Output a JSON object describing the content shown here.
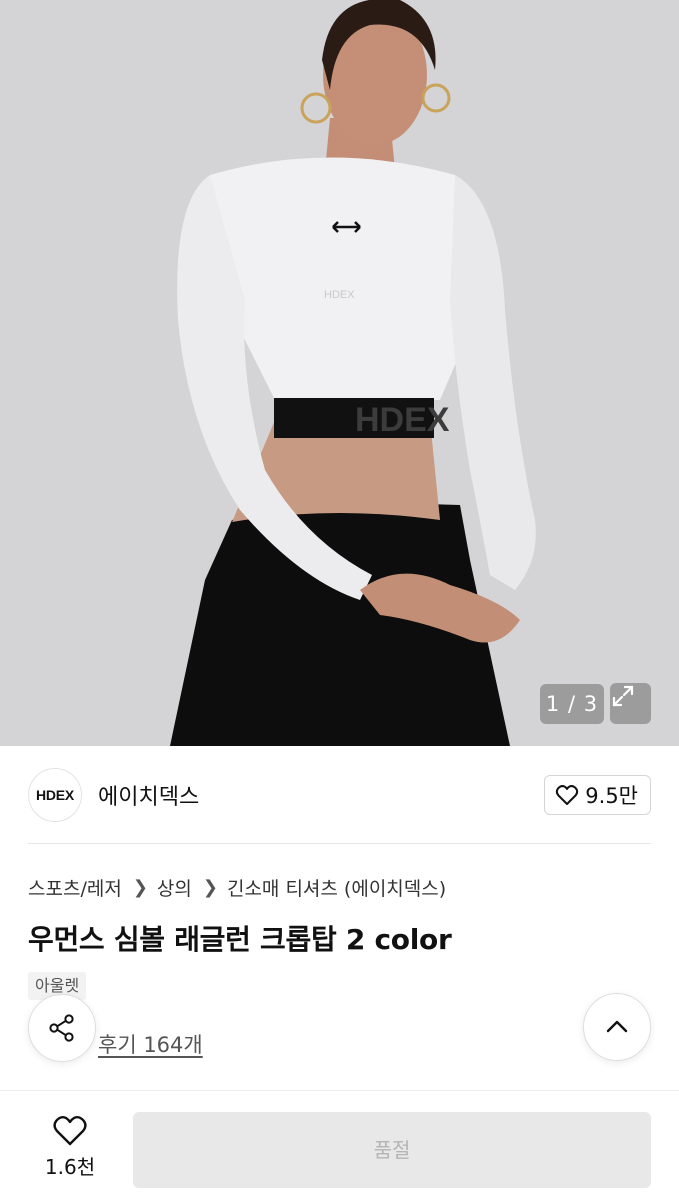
{
  "gallery": {
    "current": 1,
    "total": 3,
    "counter_text": "1 / 3",
    "print_text": "HDEX",
    "chest_text": "HDEX"
  },
  "brand": {
    "logo_text": "HDEX",
    "name": "에이치덱스",
    "like_count": "9.5만"
  },
  "breadcrumb": [
    "스포츠/레저",
    "상의",
    "긴소매 티셔츠 (에이치덱스)"
  ],
  "product": {
    "title": "우먼스 심볼 래글런 크롭탑 2 color",
    "badge": "아울렛",
    "review_link": "후기 164개"
  },
  "bottom_bar": {
    "wish_count": "1.6천",
    "option_button": "품절"
  },
  "colors": {
    "background": "#ffffff",
    "button_disabled_bg": "#e8e8e8",
    "button_disabled_text": "#b4b4b4",
    "text_primary": "#111111"
  },
  "icons": [
    "expand-icon",
    "heart-icon",
    "share-icon",
    "chevron-up-icon",
    "chevron-right-icon"
  ]
}
